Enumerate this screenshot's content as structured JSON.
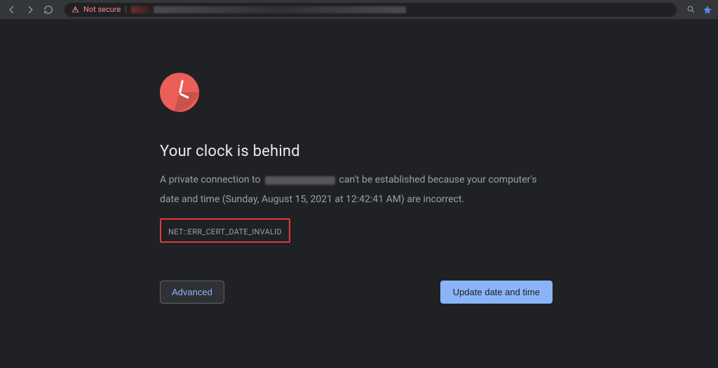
{
  "toolbar": {
    "not_secure_label": "Not secure"
  },
  "error": {
    "heading": "Your clock is behind",
    "body_prefix": "A private connection to",
    "body_suffix_1": "can't be established because your computer's",
    "body_suffix_2": "date and time (Sunday, August 15, 2021 at 12:42:41 AM) are incorrect.",
    "code": "NET::ERR_CERT_DATE_INVALID"
  },
  "buttons": {
    "advanced": "Advanced",
    "primary": "Update date and time"
  }
}
